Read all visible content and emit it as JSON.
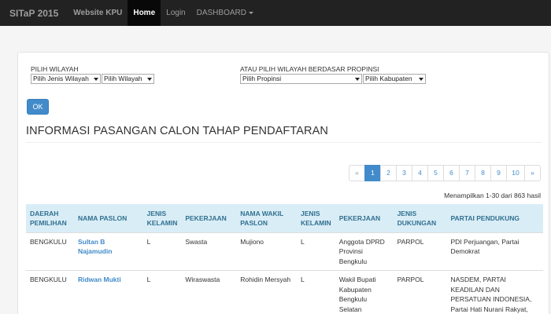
{
  "navbar": {
    "brand": "SITaP 2015",
    "items": [
      {
        "label": "Website KPU"
      },
      {
        "label": "Home"
      },
      {
        "label": "Login"
      },
      {
        "label": "DASHBOARD"
      }
    ]
  },
  "filters": {
    "left_label": "PILIH WILAYAH",
    "jenis_wilayah": "Pilih Jenis Wilayah",
    "wilayah": "Pilih Wilayah",
    "right_label": "ATAU PILIH WILAYAH BERDASAR PROPINSI",
    "propinsi": "Pilih Propinsi",
    "kabupaten": "Pilih Kabupaten",
    "ok_label": "OK"
  },
  "section": {
    "title": "INFORMASI PASANGAN CALON TAHAP PENDAFTARAN"
  },
  "pagination": {
    "prev": "«",
    "pages": [
      "1",
      "2",
      "3",
      "4",
      "5",
      "6",
      "7",
      "8",
      "9",
      "10"
    ],
    "next": "»",
    "active": "1"
  },
  "results_info": "Menampilkan 1-30 dari 863 hasil",
  "table": {
    "headers": {
      "daerah": "DAERAH PEMILIHAN",
      "nama": "NAMA PASLON",
      "jk1": "JENIS KELAMIN",
      "pekerjaan1": "PEKERJAAN",
      "wakil": "NAMA WAKIL PASLON",
      "jk2": "JENIS KELAMIN",
      "pekerjaan2": "PEKERJAAN",
      "dukungan": "JENIS DUKUNGAN",
      "partai": "PARTAI PENDUKUNG"
    },
    "rows": [
      {
        "daerah": "BENGKULU",
        "nama": "Sultan B Najamudin",
        "jk1": "L",
        "pekerjaan1": "Swasta",
        "wakil": "Mujiono",
        "jk2": "L",
        "pekerjaan2": "Anggota DPRD Provinsi Bengkulu",
        "dukungan": "PARPOL",
        "partai": "PDI Perjuangan, Partai Demokrat"
      },
      {
        "daerah": "BENGKULU",
        "nama": "Ridwan Mukti",
        "jk1": "L",
        "pekerjaan1": "Wiraswasta",
        "wakil": "Rohidin Mersyah",
        "jk2": "L",
        "pekerjaan2": "Wakil Bupati Kabupaten Bengkulu Selatan",
        "dukungan": "PARPOL",
        "partai": "NASDEM, PARTAI KEADILAN DAN PERSATUAN INDONESIA, Partai Hati Nurani Rakyat, Partai Kebangkitan Bangsa"
      }
    ]
  },
  "colors": {
    "navbar_bg": "#222222",
    "accent": "#428bca",
    "table_header_bg": "#d9edf7"
  }
}
